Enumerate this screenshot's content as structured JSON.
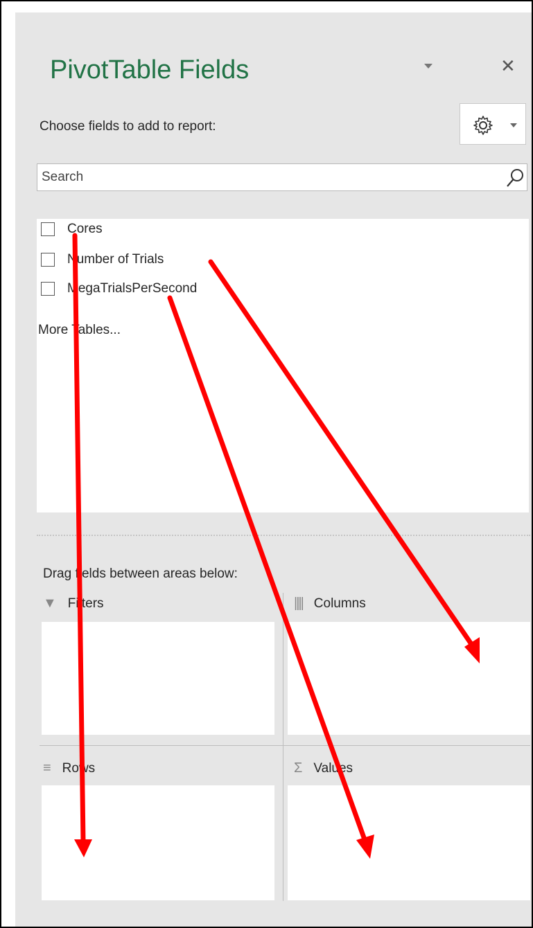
{
  "panel": {
    "title": "PivotTable Fields",
    "choose_label": "Choose fields to add to report:",
    "search": {
      "value": "",
      "placeholder": "Search"
    },
    "fields": [
      {
        "label": "Cores",
        "checked": false
      },
      {
        "label": "Number of Trials",
        "checked": false
      },
      {
        "label": "MegaTrialsPerSecond",
        "checked": false
      }
    ],
    "more_tables": "More Tables...",
    "drag_label": "Drag fields between areas below:",
    "areas": {
      "filters": {
        "label": "Filters",
        "icon": "filter-icon"
      },
      "columns": {
        "label": "Columns",
        "icon": "columns-icon"
      },
      "rows": {
        "label": "Rows",
        "icon": "rows-icon"
      },
      "values": {
        "label": "Values",
        "icon": "sigma-icon"
      }
    }
  },
  "colors": {
    "title": "#217346",
    "panel_bg": "#e6e6e6",
    "arrow": "#ff0000"
  }
}
